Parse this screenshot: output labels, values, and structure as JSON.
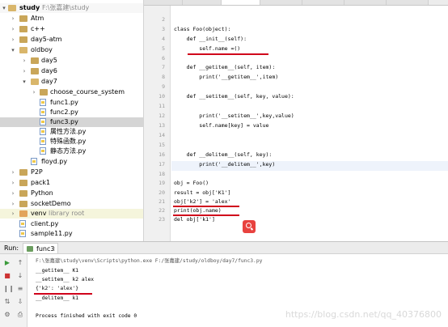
{
  "project_tree": {
    "root": {
      "name": "study",
      "path": "F:\\张嘉建\\study"
    },
    "items": [
      {
        "label": "Atm",
        "kind": "folder"
      },
      {
        "label": "c++",
        "kind": "folder"
      },
      {
        "label": "day5-atm",
        "kind": "folder"
      },
      {
        "label": "oldboy",
        "kind": "folder"
      },
      {
        "label": "day5",
        "kind": "folder"
      },
      {
        "label": "day6",
        "kind": "folder"
      },
      {
        "label": "day7",
        "kind": "folder"
      },
      {
        "label": "choose_course_system",
        "kind": "folder"
      },
      {
        "label": "func1.py",
        "kind": "py"
      },
      {
        "label": "func2.py",
        "kind": "py"
      },
      {
        "label": "func3.py",
        "kind": "py"
      },
      {
        "label": "属性方法.py",
        "kind": "py"
      },
      {
        "label": "特殊函数.py",
        "kind": "py"
      },
      {
        "label": "静态方法.py",
        "kind": "py"
      },
      {
        "label": "floyd.py",
        "kind": "py"
      },
      {
        "label": "P2P",
        "kind": "folder"
      },
      {
        "label": "pack1",
        "kind": "folder"
      },
      {
        "label": "Python",
        "kind": "folder"
      },
      {
        "label": "socketDemo",
        "kind": "folder"
      },
      {
        "label": "venv",
        "kind": "folder",
        "note": "library root"
      },
      {
        "label": "client.py",
        "kind": "py"
      },
      {
        "label": "sample11.py",
        "kind": "py"
      }
    ]
  },
  "editor": {
    "line_numbers": [
      "2",
      "3",
      "4",
      "5",
      "6",
      "7",
      "8",
      "9",
      "10",
      "11",
      "12",
      "13",
      "14",
      "15",
      "16",
      "17",
      "18",
      "19",
      "20",
      "21",
      "22",
      "23"
    ],
    "lines": [
      "",
      "class Foo(object):",
      "    def __init__(self):",
      "        self.name =()",
      "",
      "    def __getitem__(self, item):",
      "        print('__getitem__',item)",
      "",
      "    def __setitem__(self, key, value):",
      "",
      "        print('__setitem__',key,value)",
      "        self.name[key] = value",
      "",
      "",
      "    def __delitem__(self, key):",
      "        print('__delitem__',key)",
      "",
      "obj = Foo()",
      "result = obj['K1']",
      "obj['k2'] = 'alex'",
      "print(obj.name)",
      "del obj['k1']"
    ]
  },
  "run_panel": {
    "label": "Run:",
    "tab": "func3",
    "output": [
      "F:\\张嘉建\\study\\venv\\Scripts\\python.exe F:/张嘉建/study/oldboy/day7/func3.py",
      "__getitem__ K1",
      "__setitem__ k2 alex",
      "{'k2': 'alex'}",
      "__delitem__ k1",
      "",
      "Process finished with exit code 0"
    ]
  },
  "watermark": "https://blog.csdn.net/qq_40376800",
  "colors": {
    "selection": "#d5d5d5",
    "keyword": "#000080",
    "string": "#008000",
    "underline": "#d0021b"
  }
}
